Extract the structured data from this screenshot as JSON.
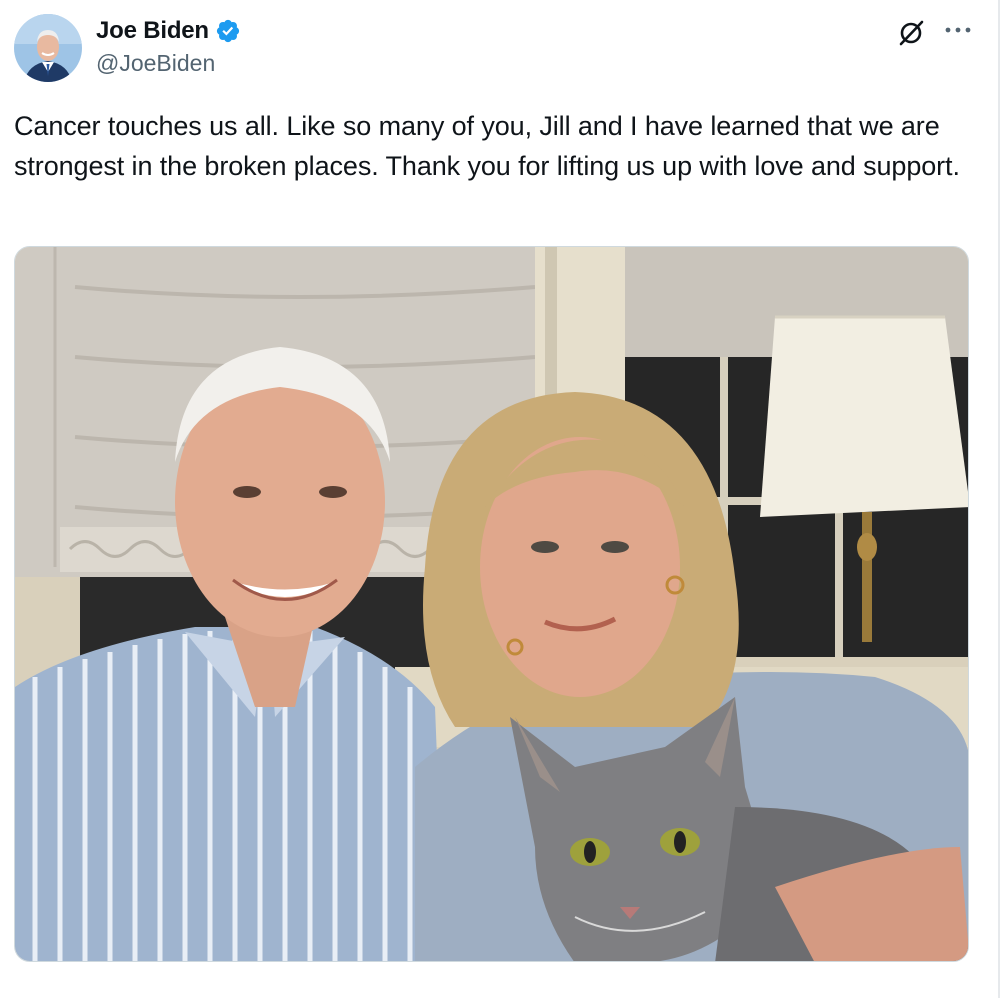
{
  "tweet": {
    "author": {
      "display_name": "Joe Biden",
      "handle": "@JoeBiden",
      "verified": true,
      "verified_icon": "verified-badge-icon",
      "verified_color": "#1d9bf0"
    },
    "text": "Cancer touches us all. Like so many of you, Jill and I have learned that we are strongest in the broken places. Thank you for lifting us up with love and support.",
    "actions": {
      "grok_icon": "grok-icon",
      "more_icon": "more-options-icon"
    }
  },
  "colors": {
    "text_primary": "#0f1419",
    "text_secondary": "#536471",
    "border": "#cfd9de"
  }
}
